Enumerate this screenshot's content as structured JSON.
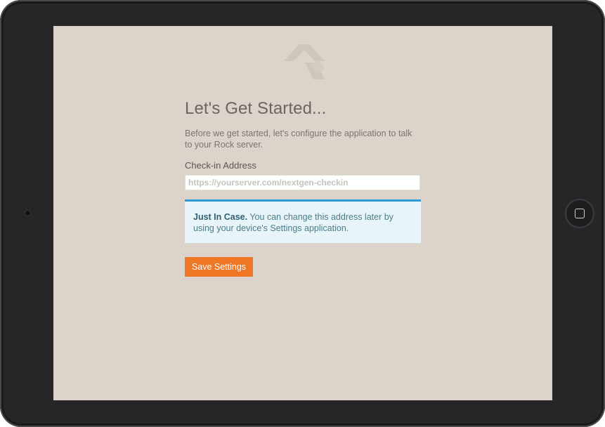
{
  "screen": {
    "logo_icon": "rock-logo-icon",
    "title": "Let's Get Started...",
    "subtitle": "Before we get started, let's configure the application to talk to your Rock server.",
    "field_label": "Check-in Address",
    "address_input": {
      "value": "",
      "placeholder": "https://yourserver.com/nextgen-checkin"
    },
    "alert": {
      "heading": "Just In Case.",
      "body": " You can change this address later by using your device's Settings application."
    },
    "save_label": "Save Settings"
  },
  "colors": {
    "background": "#dcd4ca",
    "accent_button": "#ee7624",
    "alert_border": "#2d9bd6",
    "alert_background": "#e8f5f8"
  }
}
